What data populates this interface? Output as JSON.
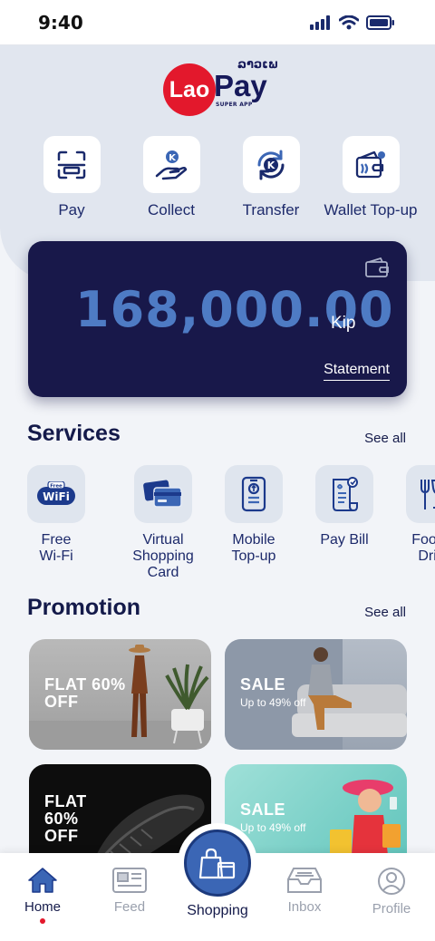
{
  "status": {
    "time": "9:40"
  },
  "brand": {
    "logo_left": "Lao",
    "logo_right": "Pay",
    "logo_script": "ລາວເພ",
    "logo_sub": "SUPER APP"
  },
  "quick_actions": [
    {
      "label": "Pay",
      "icon": "scan-icon"
    },
    {
      "label": "Collect",
      "icon": "kip-hand-icon"
    },
    {
      "label": "Transfer",
      "icon": "kip-transfer-icon"
    },
    {
      "label": "Wallet Top-up",
      "icon": "wallet-topup-icon"
    }
  ],
  "balance": {
    "amount": "168,000.00",
    "currency": "Kip",
    "statement_label": "Statement"
  },
  "services": {
    "title": "Services",
    "see_all": "See all",
    "items": [
      {
        "label": "Free\nWi-Fi",
        "icon": "wifi-icon"
      },
      {
        "label": "Virtual\nShopping\nCard",
        "icon": "cards-icon"
      },
      {
        "label": "Mobile\nTop-up",
        "icon": "mobile-topup-icon"
      },
      {
        "label": "Pay Bill",
        "icon": "bill-icon"
      },
      {
        "label": "Food &\nDrink",
        "icon": "food-drink-icon"
      }
    ]
  },
  "promotion": {
    "title": "Promotion",
    "see_all": "See all",
    "items": [
      {
        "title": "FLAT 60%\nOFF",
        "subtitle": ""
      },
      {
        "title": "SALE",
        "subtitle": "Up to 49% off"
      },
      {
        "title": "FLAT\n60%\nOFF",
        "subtitle": ""
      },
      {
        "title": "SALE",
        "subtitle": "Up to 49% off"
      }
    ]
  },
  "nav": {
    "home": "Home",
    "feed": "Feed",
    "shopping": "Shopping",
    "inbox": "Inbox",
    "profile": "Profile"
  },
  "colors": {
    "brand_navy": "#18184a",
    "brand_red": "#e3182c",
    "accent_blue": "#3b66b5",
    "amount_blue": "#4e7bc4"
  }
}
